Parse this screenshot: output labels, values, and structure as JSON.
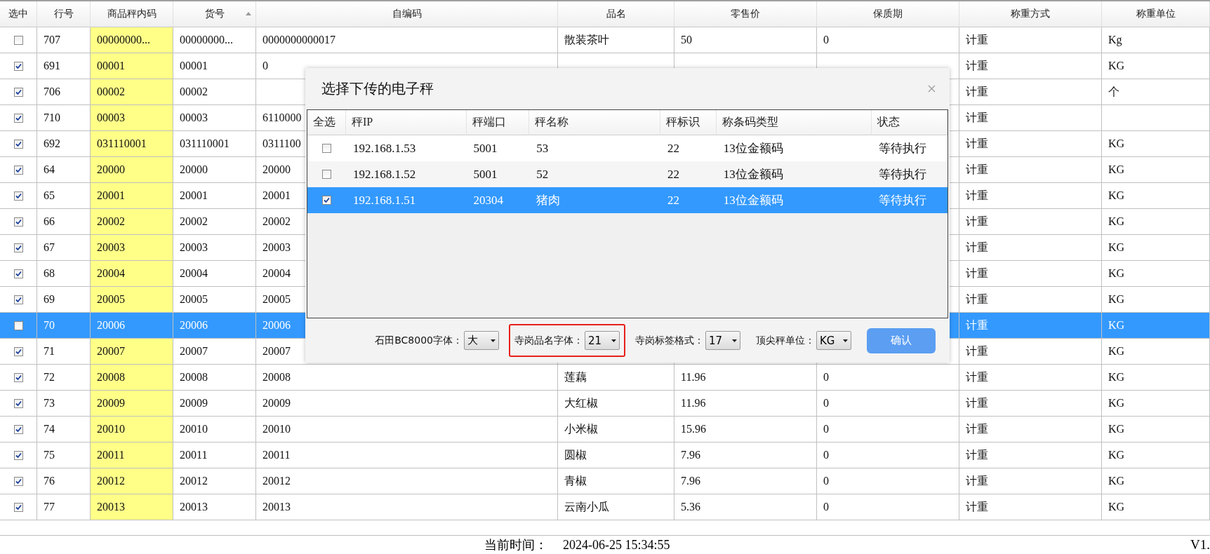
{
  "table": {
    "columns": [
      {
        "label": "选中"
      },
      {
        "label": "行号"
      },
      {
        "label": "商品秤内码"
      },
      {
        "label": "货号",
        "sorted": true
      },
      {
        "label": "自编码"
      },
      {
        "label": "品名"
      },
      {
        "label": "零售价"
      },
      {
        "label": "保质期"
      },
      {
        "label": "称重方式"
      },
      {
        "label": "称重单位"
      }
    ],
    "rows": [
      {
        "checked": false,
        "selected": false,
        "cells": {
          "row_no": "707",
          "scale_code": "00000000...",
          "item_no": "00000000...",
          "self_code": "0000000000017",
          "name": "散装茶叶",
          "price": "50",
          "shelf_life": "0",
          "weigh_mode": "计重",
          "weigh_unit": "Kg"
        }
      },
      {
        "checked": true,
        "selected": false,
        "cells": {
          "row_no": "691",
          "scale_code": "00001",
          "item_no": "00001",
          "self_code": "0",
          "weigh_mode": "计重",
          "weigh_unit": "KG"
        }
      },
      {
        "checked": true,
        "selected": false,
        "cells": {
          "row_no": "706",
          "scale_code": "00002",
          "item_no": "00002",
          "weigh_mode": "计重",
          "weigh_unit": "个"
        }
      },
      {
        "checked": true,
        "selected": false,
        "cells": {
          "row_no": "710",
          "scale_code": "00003",
          "item_no": "00003",
          "self_code": "6110000",
          "weigh_mode": "计重"
        }
      },
      {
        "checked": true,
        "selected": false,
        "cells": {
          "row_no": "692",
          "scale_code": "031110001",
          "item_no": "031110001",
          "self_code": "0311100",
          "weigh_mode": "计重",
          "weigh_unit": "KG"
        }
      },
      {
        "checked": true,
        "selected": false,
        "cells": {
          "row_no": "64",
          "scale_code": "20000",
          "item_no": "20000",
          "self_code": "20000",
          "weigh_mode": "计重",
          "weigh_unit": "KG"
        }
      },
      {
        "checked": true,
        "selected": false,
        "cells": {
          "row_no": "65",
          "scale_code": "20001",
          "item_no": "20001",
          "self_code": "20001",
          "weigh_mode": "计重",
          "weigh_unit": "KG"
        }
      },
      {
        "checked": true,
        "selected": false,
        "cells": {
          "row_no": "66",
          "scale_code": "20002",
          "item_no": "20002",
          "self_code": "20002",
          "weigh_mode": "计重",
          "weigh_unit": "KG"
        }
      },
      {
        "checked": true,
        "selected": false,
        "cells": {
          "row_no": "67",
          "scale_code": "20003",
          "item_no": "20003",
          "self_code": "20003",
          "weigh_mode": "计重",
          "weigh_unit": "KG"
        }
      },
      {
        "checked": true,
        "selected": false,
        "cells": {
          "row_no": "68",
          "scale_code": "20004",
          "item_no": "20004",
          "self_code": "20004",
          "weigh_mode": "计重",
          "weigh_unit": "KG"
        }
      },
      {
        "checked": true,
        "selected": false,
        "cells": {
          "row_no": "69",
          "scale_code": "20005",
          "item_no": "20005",
          "self_code": "20005",
          "weigh_mode": "计重",
          "weigh_unit": "KG"
        }
      },
      {
        "checked": false,
        "selected": true,
        "cells": {
          "row_no": "70",
          "scale_code": "20006",
          "item_no": "20006",
          "self_code": "20006",
          "weigh_mode": "计重",
          "weigh_unit": "KG"
        }
      },
      {
        "checked": true,
        "selected": false,
        "cells": {
          "row_no": "71",
          "scale_code": "20007",
          "item_no": "20007",
          "self_code": "20007",
          "weigh_mode": "计重",
          "weigh_unit": "KG"
        }
      },
      {
        "checked": true,
        "selected": false,
        "cells": {
          "row_no": "72",
          "scale_code": "20008",
          "item_no": "20008",
          "self_code": "20008",
          "name": "莲藕",
          "price": "11.96",
          "shelf_life": "0",
          "weigh_mode": "计重",
          "weigh_unit": "KG"
        }
      },
      {
        "checked": true,
        "selected": false,
        "cells": {
          "row_no": "73",
          "scale_code": "20009",
          "item_no": "20009",
          "self_code": "20009",
          "name": "大红椒",
          "price": "11.96",
          "shelf_life": "0",
          "weigh_mode": "计重",
          "weigh_unit": "KG"
        }
      },
      {
        "checked": true,
        "selected": false,
        "cells": {
          "row_no": "74",
          "scale_code": "20010",
          "item_no": "20010",
          "self_code": "20010",
          "name": "小米椒",
          "price": "15.96",
          "shelf_life": "0",
          "weigh_mode": "计重",
          "weigh_unit": "KG"
        }
      },
      {
        "checked": true,
        "selected": false,
        "cells": {
          "row_no": "75",
          "scale_code": "20011",
          "item_no": "20011",
          "self_code": "20011",
          "name": "圆椒",
          "price": "7.96",
          "shelf_life": "0",
          "weigh_mode": "计重",
          "weigh_unit": "KG"
        }
      },
      {
        "checked": true,
        "selected": false,
        "cells": {
          "row_no": "76",
          "scale_code": "20012",
          "item_no": "20012",
          "self_code": "20012",
          "name": "青椒",
          "price": "7.96",
          "shelf_life": "0",
          "weigh_mode": "计重",
          "weigh_unit": "KG"
        }
      },
      {
        "checked": true,
        "selected": false,
        "cells": {
          "row_no": "77",
          "scale_code": "20013",
          "item_no": "20013",
          "self_code": "20013",
          "name": "云南小瓜",
          "price": "5.36",
          "shelf_life": "0",
          "weigh_mode": "计重",
          "weigh_unit": "KG"
        }
      }
    ]
  },
  "dialog": {
    "title": "选择下传的电子秤",
    "check_column": "全选",
    "columns": [
      {
        "label": "秤IP"
      },
      {
        "label": "秤端口"
      },
      {
        "label": "秤名称"
      },
      {
        "label": "秤标识"
      },
      {
        "label": "称条码类型"
      },
      {
        "label": "状态"
      }
    ],
    "rows": [
      {
        "checked": false,
        "selected": false,
        "cells": [
          "192.168.1.53",
          "5001",
          "53",
          "22",
          "13位金额码",
          "等待执行"
        ]
      },
      {
        "checked": false,
        "selected": false,
        "cells": [
          "192.168.1.52",
          "5001",
          "52",
          "22",
          "13位金额码",
          "等待执行"
        ]
      },
      {
        "checked": true,
        "selected": true,
        "cells": [
          "192.168.1.51",
          "20304",
          "猪肉",
          "22",
          "13位金额码",
          "等待执行"
        ]
      }
    ],
    "options": [
      {
        "label": "石田BC8000字体：",
        "value": "大",
        "highlighted": false
      },
      {
        "label": "寺岗品名字体：",
        "value": "21",
        "highlighted": true
      },
      {
        "label": "寺岗标签格式：",
        "value": "17",
        "highlighted": false
      },
      {
        "label": "顶尖秤单位：",
        "value": "KG",
        "highlighted": false
      }
    ],
    "confirm": "确认"
  },
  "status_bar": {
    "time_label": "当前时间：",
    "time": "2024-06-25 15:34:55",
    "version": "V1."
  }
}
